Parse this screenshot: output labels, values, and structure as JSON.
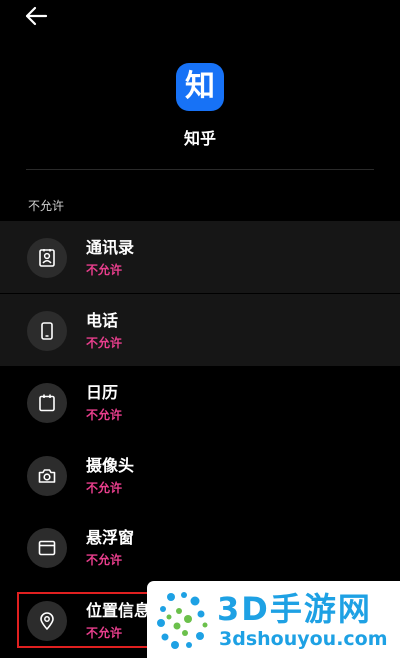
{
  "app": {
    "name": "知乎",
    "icon_glyph": "知",
    "icon_color": "#1772f6"
  },
  "section": {
    "label": "不允许"
  },
  "status_color": "#e83e8c",
  "permissions": [
    {
      "title": "通讯录",
      "status": "不允许",
      "icon": "contacts-icon",
      "highlighted": true
    },
    {
      "title": "电话",
      "status": "不允许",
      "icon": "phone-icon",
      "highlighted": true
    },
    {
      "title": "日历",
      "status": "不允许",
      "icon": "calendar-icon",
      "highlighted": false
    },
    {
      "title": "摄像头",
      "status": "不允许",
      "icon": "camera-icon",
      "highlighted": false
    },
    {
      "title": "悬浮窗",
      "status": "不允许",
      "icon": "floating-window-icon",
      "highlighted": false
    },
    {
      "title": "位置信息",
      "status": "不允许",
      "icon": "location-icon",
      "highlighted": false
    }
  ],
  "watermark": {
    "title": "3D手游网",
    "url": "3dshouyou.com",
    "color": "#1ea1e4"
  }
}
